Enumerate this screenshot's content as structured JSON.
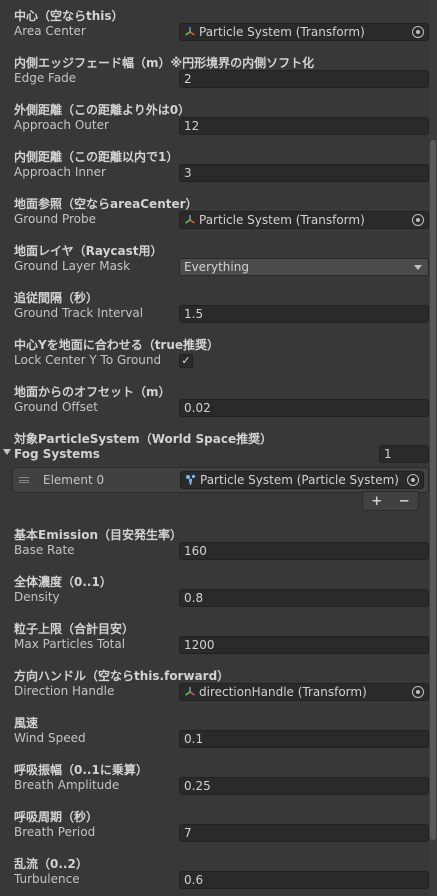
{
  "fields": [
    {
      "header": "中心（空ならthis）",
      "label": "Area Center",
      "kind": "object",
      "value": "Particle System (Transform)",
      "icon": "transform-icon"
    },
    {
      "header": "内側エッジフェード幅（m）※円形境界の内側ソフト化",
      "label": "Edge Fade",
      "kind": "number",
      "value": "2"
    },
    {
      "header": "外側距離（この距離より外は0）",
      "label": "Approach Outer",
      "kind": "number",
      "value": "12"
    },
    {
      "header": "内側距離（この距離以内で1）",
      "label": "Approach Inner",
      "kind": "number",
      "value": "3"
    },
    {
      "header": "地面参照（空ならareaCenter）",
      "label": "Ground Probe",
      "kind": "object",
      "value": "Particle System (Transform)",
      "icon": "transform-icon"
    },
    {
      "header": "地面レイヤ（Raycast用）",
      "label": "Ground Layer Mask",
      "kind": "dropdown",
      "value": "Everything"
    },
    {
      "header": "追従間隔（秒）",
      "label": "Ground Track Interval",
      "kind": "number",
      "value": "1.5"
    },
    {
      "header": "中心Yを地面に合わせる（true推奨）",
      "label": "Lock Center Y To Ground",
      "kind": "checkbox",
      "value": "✓"
    },
    {
      "header": "地面からのオフセット（m）",
      "label": "Ground Offset",
      "kind": "number",
      "value": "0.02"
    },
    {
      "header": "対象ParticleSystem（World Space推奨）",
      "label": "",
      "kind": "none",
      "value": ""
    }
  ],
  "fog_systems": {
    "label": "Fog Systems",
    "count": "1",
    "element_label": "Element 0",
    "element_value": "Particle System (Particle System)",
    "add_label": "+",
    "remove_label": "−"
  },
  "fields2": [
    {
      "header": "基本Emission（目安発生率）",
      "label": "Base Rate",
      "kind": "number",
      "value": "160"
    },
    {
      "header": "全体濃度（0..1）",
      "label": "Density",
      "kind": "number",
      "value": "0.8"
    },
    {
      "header": "粒子上限（合計目安）",
      "label": "Max Particles Total",
      "kind": "number",
      "value": "1200"
    },
    {
      "header": "方向ハンドル（空ならthis.forward）",
      "label": "Direction Handle",
      "kind": "object",
      "value": "directionHandle (Transform)",
      "icon": "transform-icon"
    },
    {
      "header": "風速",
      "label": "Wind Speed",
      "kind": "number",
      "value": "0.1"
    },
    {
      "header": "呼吸振幅（0..1に乗算）",
      "label": "Breath Amplitude",
      "kind": "number",
      "value": "0.25"
    },
    {
      "header": "呼吸周期（秒）",
      "label": "Breath Period",
      "kind": "number",
      "value": "7"
    },
    {
      "header": "乱流（0..2）",
      "label": "Turbulence",
      "kind": "number",
      "value": "0.6"
    }
  ],
  "colors": {
    "background": "#383838",
    "field": "#2a2a2a",
    "text": "#c4c4c4"
  }
}
